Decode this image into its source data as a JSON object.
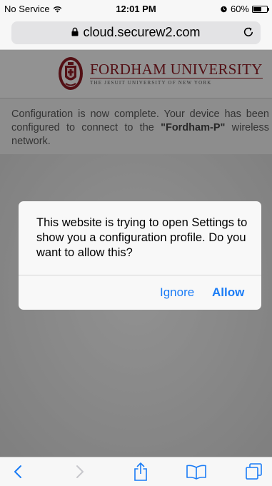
{
  "status_bar": {
    "carrier": "No Service",
    "time": "12:01 PM",
    "battery_text": "60%",
    "battery_level": 0.6
  },
  "address_bar": {
    "url": "cloud.securew2.com"
  },
  "page": {
    "logo": {
      "name": "FORDHAM UNIVERSITY",
      "tagline": "THE JESUIT UNIVERSITY OF NEW YORK"
    },
    "message": {
      "before": "Configuration is now complete. Your device has been configured to connect to the ",
      "network": "\"Fordham-P\"",
      "after": " wireless network."
    }
  },
  "alert": {
    "message": "This website is trying to open Settings to show you a configuration profile. Do you want to allow this?",
    "ignore_label": "Ignore",
    "allow_label": "Allow"
  },
  "toolbar": {
    "items": [
      "back-icon",
      "forward-icon",
      "share-icon",
      "bookmarks-icon",
      "tabs-icon"
    ]
  },
  "colors": {
    "accent": "#1a7cf6",
    "brand": "#8b1c24"
  }
}
